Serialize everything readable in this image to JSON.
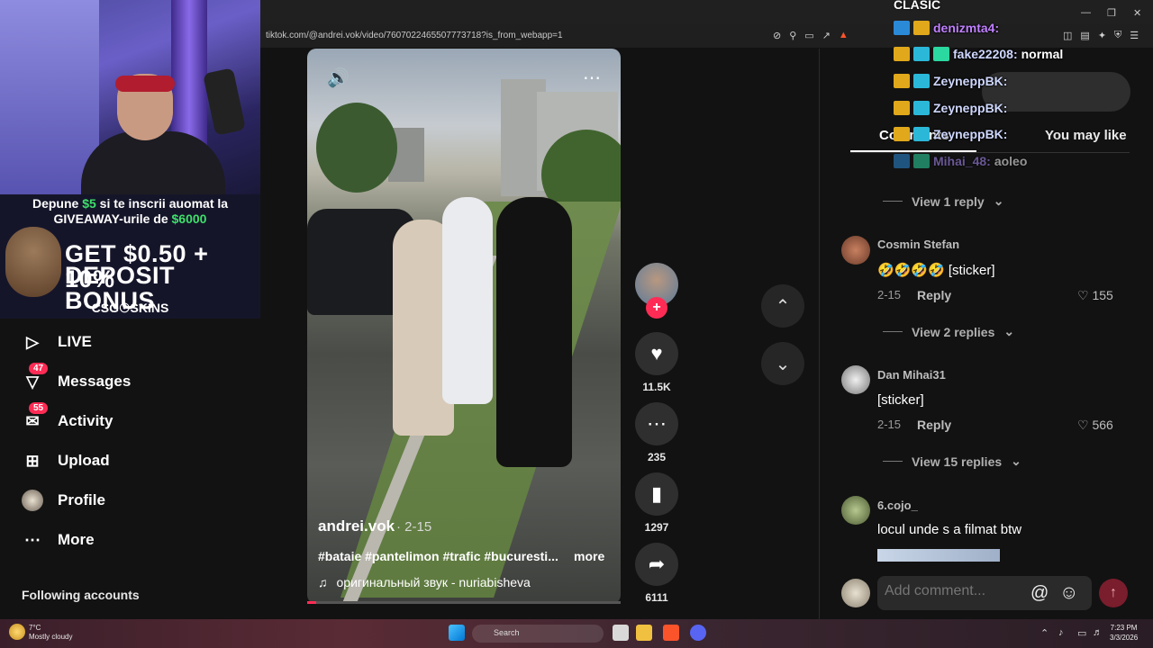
{
  "browser": {
    "url": "tiktok.com/@andrei.vok/video/7607022465507773718?is_from_webapp=1"
  },
  "stream_overlay": {
    "promo_line1_prefix": "Depune ",
    "promo_line1_amount": "$5",
    "promo_line1_suffix": " si te inscrii auomat la",
    "promo_line2_prefix": "GIVEAWAY-urile de ",
    "promo_line2_amount": "$6000",
    "promo_big1": "GET $0.50 + 10%",
    "promo_big2": "DEPOSIT BONUS",
    "promo_brand": "CSG☉SKINS",
    "chat_header": "CLASIC",
    "chat": [
      {
        "user": "denizmta4:",
        "msg": ""
      },
      {
        "user": "fake22208:",
        "msg": "normal"
      },
      {
        "user": "ZeyneppBK:",
        "msg": ""
      },
      {
        "user": "ZeyneppBK:",
        "msg": ""
      },
      {
        "user": "ZeyneppBK:",
        "msg": ""
      },
      {
        "user": "Mihai_48:",
        "msg": "aoleo"
      }
    ]
  },
  "sidebar": {
    "items": [
      {
        "label": "LIVE",
        "icon": "live-icon",
        "badge": ""
      },
      {
        "label": "Messages",
        "icon": "messages-icon",
        "badge": "47"
      },
      {
        "label": "Activity",
        "icon": "activity-icon",
        "badge": "55"
      },
      {
        "label": "Upload",
        "icon": "upload-icon",
        "badge": ""
      },
      {
        "label": "Profile",
        "icon": "profile-icon",
        "badge": ""
      },
      {
        "label": "More",
        "icon": "more-icon",
        "badge": ""
      }
    ],
    "following_title": "Following accounts"
  },
  "video": {
    "author": "andrei.vok",
    "date": "· 2-15",
    "caption": "#bataie #pantelimon #trafic #bucuresti...",
    "more_label": "more",
    "music": "оригинальный звук - nuriabisheva",
    "progress": 0.03
  },
  "actions": {
    "likes": "11.5K",
    "comments": "235",
    "saves": "1297",
    "shares": "6111"
  },
  "comments_panel": {
    "tab_comments": "Comments",
    "tab_like": "You may like",
    "top_view_reply": "View 1 reply",
    "comments": [
      {
        "name": "Cosmin Stefan",
        "text": "🤣🤣🤣🤣 [sticker]",
        "date": "2-15",
        "reply": "Reply",
        "likes": "155",
        "view": "View 2 replies"
      },
      {
        "name": "Dan Mihai31",
        "text": "[sticker]",
        "date": "2-15",
        "reply": "Reply",
        "likes": "566",
        "view": "View 15 replies"
      },
      {
        "name": "6.cojo_",
        "text": "locul unde s a filmat btw",
        "date": "",
        "reply": "",
        "likes": "",
        "view": ""
      }
    ],
    "input_placeholder": "Add comment..."
  },
  "taskbar": {
    "temp": "7°C",
    "weather": "Mostly cloudy",
    "search": "Search",
    "time": "7:23 PM",
    "date": "3/3/2026"
  },
  "colors": {
    "accent": "#fe2c55",
    "background": "#121212"
  }
}
